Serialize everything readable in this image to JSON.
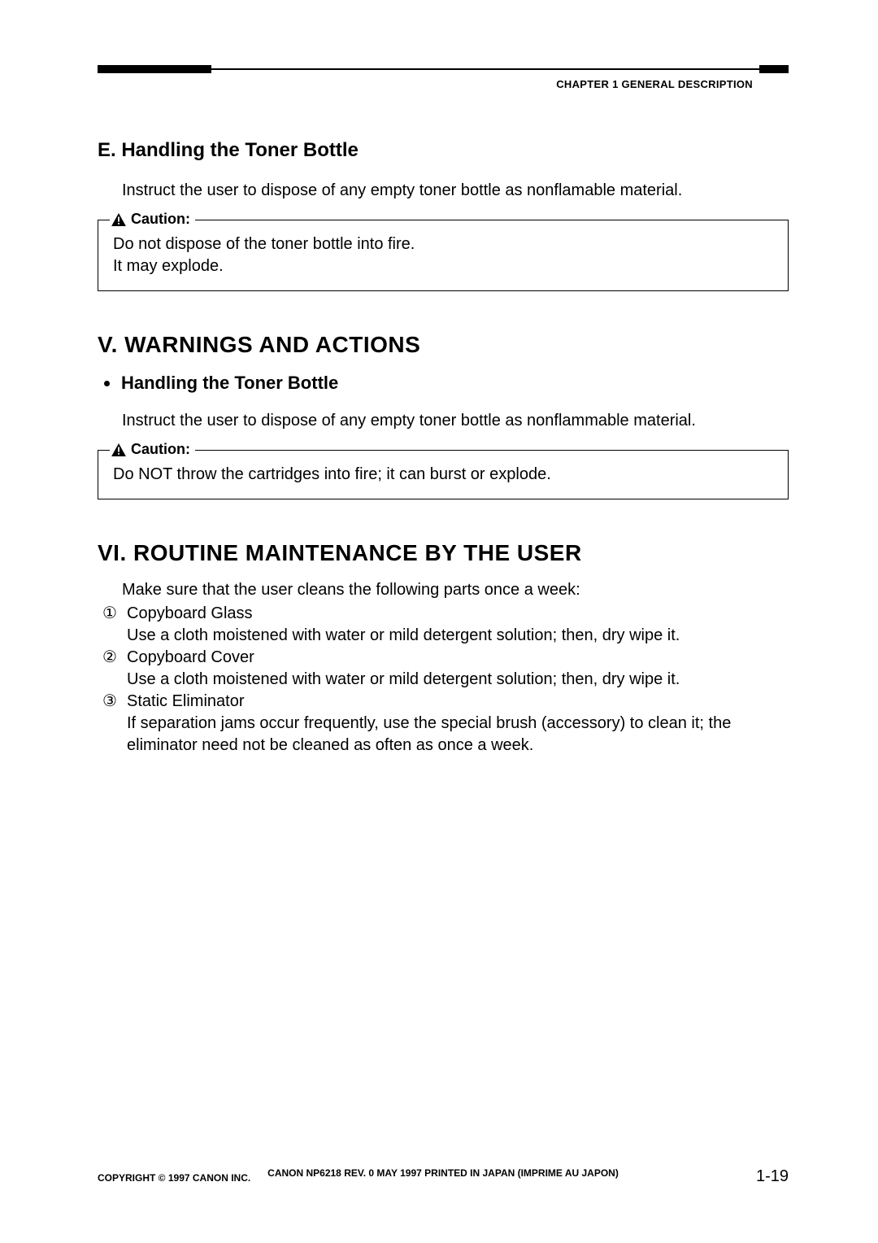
{
  "header": {
    "chapter": "CHAPTER 1  GENERAL DESCRIPTION"
  },
  "sectionE": {
    "title": "E. Handling the Toner Bottle",
    "body": "Instruct the user to dispose of any empty toner bottle as nonflamable material.",
    "caution_label": "Caution:",
    "caution_line1": "Do not dispose of the toner bottle into fire.",
    "caution_line2": "It may explode."
  },
  "sectionV": {
    "heading": "V. WARNINGS AND ACTIONS",
    "sub_bullet": "Handling the Toner Bottle",
    "body": "Instruct the user to dispose of any empty toner bottle as nonflammable material.",
    "caution_label": "Caution:",
    "caution_text": "Do NOT throw the cartridges into fire; it can burst or explode."
  },
  "sectionVI": {
    "heading": "VI. ROUTINE MAINTENANCE BY THE USER",
    "intro": "Make sure that the user cleans the following parts once a week:",
    "items": [
      {
        "num": "①",
        "title": "Copyboard Glass",
        "desc": "Use a cloth moistened with water or mild detergent solution; then, dry wipe it."
      },
      {
        "num": "②",
        "title": "Copyboard Cover",
        "desc": "Use a cloth moistened with water or mild detergent solution; then, dry wipe it."
      },
      {
        "num": "③",
        "title": "Static Eliminator",
        "desc": "If separation jams occur frequently, use the special brush (accessory) to clean it; the eliminator need not be cleaned as often as once a week."
      }
    ]
  },
  "footer": {
    "copyright": "COPYRIGHT © 1997 CANON INC.",
    "center": "CANON NP6218 REV. 0 MAY 1997 PRINTED IN JAPAN (IMPRIME AU JAPON)",
    "page": "1-19"
  }
}
